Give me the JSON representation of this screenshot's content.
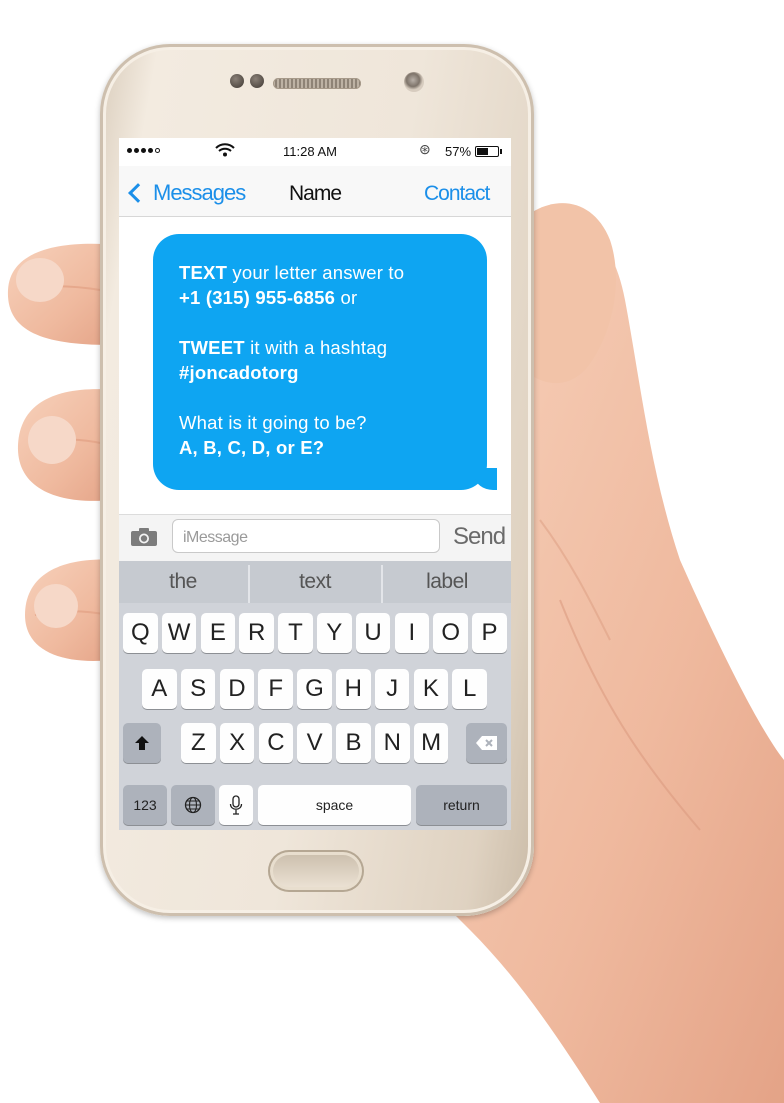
{
  "status_bar": {
    "time": "11:28 AM",
    "battery_percent": "57%",
    "battery_level": 0.57,
    "signal_icon": "signal-dots-icon",
    "wifi_icon": "wifi-icon",
    "bluetooth_icon": "bluetooth-icon"
  },
  "nav": {
    "back_label": "Messages",
    "title": "Name",
    "contact_label": "Contact",
    "accent_color": "#1b8fe9"
  },
  "message": {
    "bubble_color": "#0ea5f2",
    "line1_bold": "TEXT",
    "line1_rest": " your letter answer to",
    "line2_bold": "+1 (315) 955-6856",
    "line2_rest": " or",
    "line3_bold": "TWEET",
    "line3_rest": " it with a hashtag",
    "line4_bold": "#joncadotorg",
    "line5": "What is it going to be?",
    "line6_bold": "A, B, C, D, or E?"
  },
  "composer": {
    "placeholder": "iMessage",
    "send_label": "Send",
    "camera_icon": "camera-icon"
  },
  "keyboard": {
    "suggestions": [
      "the",
      "text",
      "label"
    ],
    "row1": [
      "Q",
      "W",
      "E",
      "R",
      "T",
      "Y",
      "U",
      "I",
      "O",
      "P"
    ],
    "row2": [
      "A",
      "S",
      "D",
      "F",
      "G",
      "H",
      "J",
      "K",
      "L"
    ],
    "row3": [
      "Z",
      "X",
      "C",
      "V",
      "B",
      "N",
      "M"
    ],
    "numbers_label": "123",
    "space_label": "space",
    "return_label": "return",
    "shift_icon": "shift-arrow-icon",
    "delete_icon": "backspace-icon",
    "globe_icon": "globe-icon",
    "mic_icon": "microphone-icon"
  }
}
